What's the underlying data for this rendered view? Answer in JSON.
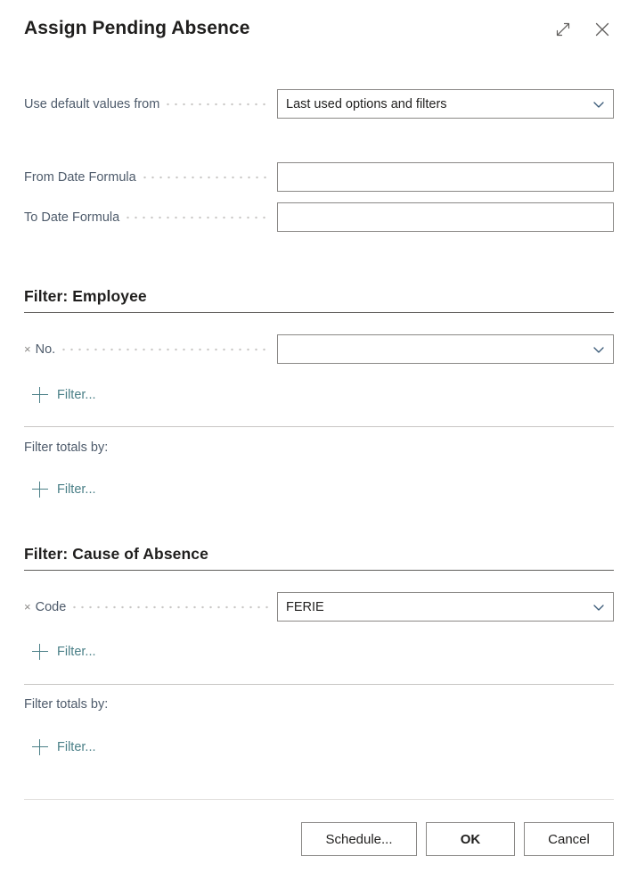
{
  "dialog": {
    "title": "Assign Pending Absence",
    "header_actions": [
      {
        "name": "expand-icon",
        "label": "Expand"
      },
      {
        "name": "close-icon",
        "label": "Close"
      }
    ]
  },
  "options": {
    "default_values": {
      "label": "Use default values from",
      "value": "Last used options and filters",
      "control": "dropdown"
    },
    "from_date_formula": {
      "label": "From Date Formula",
      "value": "",
      "control": "text"
    },
    "to_date_formula": {
      "label": "To Date Formula",
      "value": "",
      "control": "text"
    }
  },
  "filter_employee": {
    "title": "Filter: Employee",
    "field": {
      "label": "No.",
      "value": "",
      "remove_icon": "×"
    },
    "add_filter_label": "Filter...",
    "totals_label": "Filter totals by:",
    "totals_add_filter_label": "Filter..."
  },
  "filter_cause_of_absence": {
    "title": "Filter: Cause of Absence",
    "field": {
      "label": "Code",
      "value": "FERIE",
      "remove_icon": "×"
    },
    "add_filter_label": "Filter...",
    "totals_label": "Filter totals by:",
    "totals_add_filter_label": "Filter..."
  },
  "footer": {
    "schedule_label": "Schedule...",
    "ok_label": "OK",
    "cancel_label": "Cancel"
  },
  "colors": {
    "accent_link": "#4a7f87",
    "label_text": "#4e5b6b",
    "body_text": "#201f1e",
    "border": "#8a8886",
    "rule": "#605e5c",
    "divider": "#c8c6c4"
  }
}
